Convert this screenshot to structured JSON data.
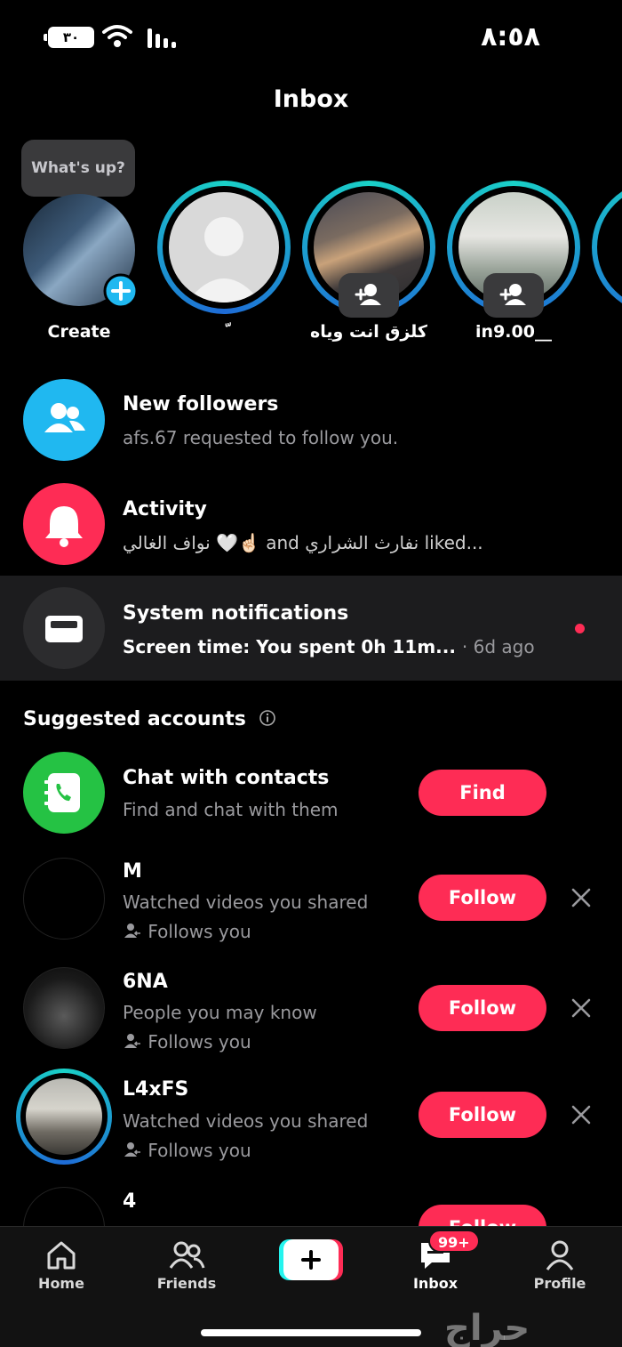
{
  "status_bar": {
    "battery": "٣٠",
    "time": "٨:٥٨"
  },
  "header": {
    "title": "Inbox"
  },
  "stories": {
    "create_bubble": "What's up?",
    "items": [
      {
        "label": "Create",
        "icon": "plus-icon"
      },
      {
        "label": "ّ",
        "icon": "user-placeholder-icon"
      },
      {
        "label": "كلزق انت وياه",
        "icon": "add-friend-icon"
      },
      {
        "label": "in9.00__",
        "icon": "add-friend-icon"
      }
    ]
  },
  "notifications": [
    {
      "title": "New followers",
      "subtitle": "afs.67 requested to follow you.",
      "icon": "people-icon",
      "color": "#20b8f0"
    },
    {
      "title": "Activity",
      "subtitle": "نواف الغالي 🤍☝🏻 and نفارث الشراري liked...",
      "icon": "bell-icon",
      "color": "#fe2c55"
    },
    {
      "title": "System notifications",
      "subtitle": "Screen time: You spent 0h 11m...",
      "time": "· 6d ago",
      "icon": "inbox-tray-icon",
      "color": "#2c2c2e"
    }
  ],
  "suggested": {
    "title": "Suggested accounts",
    "contacts": {
      "title": "Chat with contacts",
      "subtitle": "Find and chat with them",
      "button": "Find"
    },
    "accounts": [
      {
        "name": "M",
        "reason": "Watched videos you shared",
        "follows": "Follows you",
        "button": "Follow"
      },
      {
        "name": "6NA",
        "reason": "People you may know",
        "follows": "Follows you",
        "button": "Follow"
      },
      {
        "name": "L4xFS",
        "reason": "Watched videos you shared",
        "follows": "Follows you",
        "button": "Follow"
      },
      {
        "name": "4",
        "button": "Follow"
      }
    ]
  },
  "nav": {
    "items": [
      {
        "label": "Home",
        "icon": "home-icon"
      },
      {
        "label": "Friends",
        "icon": "friends-icon"
      },
      {
        "label": "",
        "icon": "create-plus-icon"
      },
      {
        "label": "Inbox",
        "icon": "inbox-icon",
        "badge": "99+"
      },
      {
        "label": "Profile",
        "icon": "profile-icon"
      }
    ]
  },
  "watermark": "حراج",
  "colors": {
    "accent": "#fe2c55",
    "ring": "#1ad1c7",
    "contacts_green": "#25c244"
  }
}
